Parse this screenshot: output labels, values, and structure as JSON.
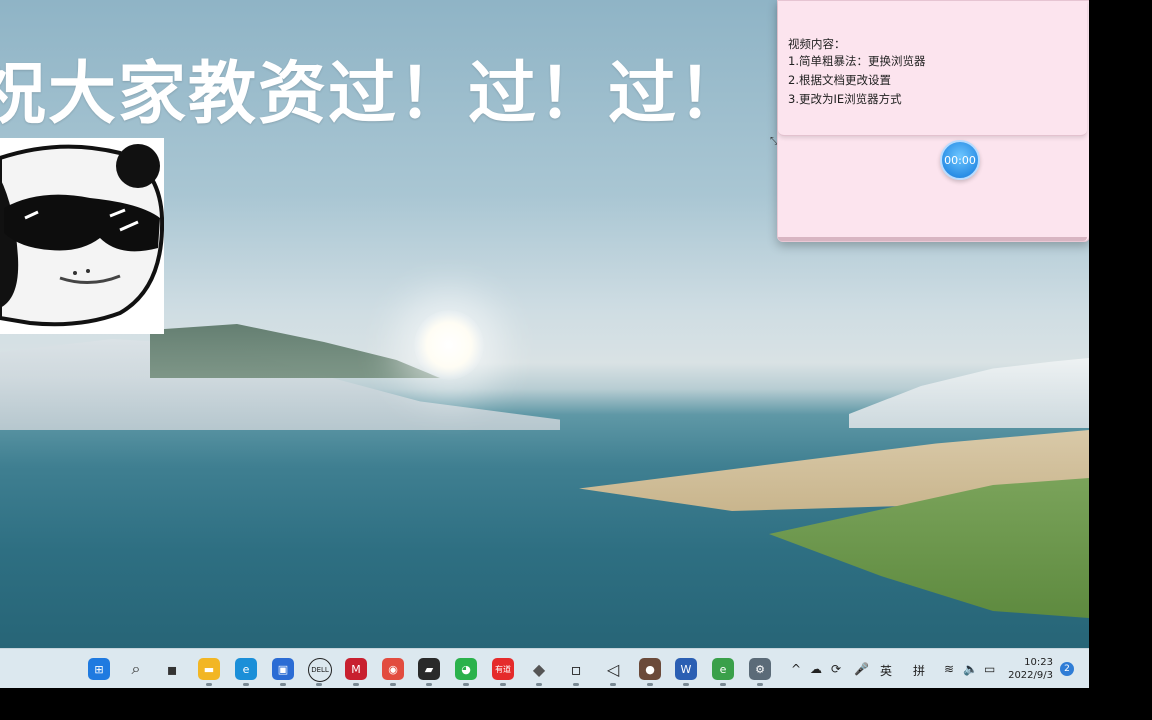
{
  "overlay": {
    "title": "祝大家教资过！过！过！"
  },
  "popup": {
    "header": "视频内容：",
    "lines": [
      "1.简单粗暴法：更换浏览器",
      "2.根据文档更改设置",
      "3.更改为IE浏览器方式"
    ]
  },
  "timer": {
    "label": "00:00"
  },
  "taskbar": {
    "apps": [
      {
        "name": "start-icon",
        "glyph": "⊞",
        "color": "#1f7ae0"
      },
      {
        "name": "search-icon",
        "glyph": "⌕",
        "color": "#333333"
      },
      {
        "name": "task-view-icon",
        "glyph": "▪",
        "color": "#333333"
      },
      {
        "name": "file-explorer-icon",
        "glyph": "▬",
        "color": "#f2b624"
      },
      {
        "name": "edge-icon",
        "glyph": "e",
        "color": "#1b8fd8"
      },
      {
        "name": "store-icon",
        "glyph": "▣",
        "color": "#2b6cd4"
      },
      {
        "name": "dell-icon",
        "glyph": "DELL",
        "color": "#1b1b1b"
      },
      {
        "name": "mcafee-icon",
        "glyph": "M",
        "color": "#c8202f"
      },
      {
        "name": "chrome-icon",
        "glyph": "◉",
        "color": "#e24c3f"
      },
      {
        "name": "sticky-notes-icon",
        "glyph": "▰",
        "color": "#2a2a2a"
      },
      {
        "name": "wechat-icon",
        "glyph": "◕",
        "color": "#2bb24c"
      },
      {
        "name": "youdao-icon",
        "glyph": "有道",
        "color": "#e52b2b"
      },
      {
        "name": "3d-viewer-icon",
        "glyph": "◆",
        "color": "#555555"
      },
      {
        "name": "notepad-app-icon",
        "glyph": "▫",
        "color": "#222222"
      },
      {
        "name": "visual-studio-icon",
        "glyph": "◁",
        "color": "#222222"
      },
      {
        "name": "avatar-app-icon",
        "glyph": "●",
        "color": "#6b4a3a"
      },
      {
        "name": "word-icon",
        "glyph": "W",
        "color": "#2b5fb3"
      },
      {
        "name": "ie-icon",
        "glyph": "e",
        "color": "#3aa04a"
      },
      {
        "name": "settings-icon",
        "glyph": "⚙",
        "color": "#5b6b78"
      }
    ],
    "tray": {
      "chevron": "^",
      "cloud": "☁",
      "sync": "⟳",
      "mic": "🎤",
      "ime_lang": "英",
      "ime_mode": "拼",
      "wifi": "≋",
      "volume": "🔈",
      "battery": "▭"
    },
    "clock": {
      "time": "10:23",
      "date": "2022/9/3"
    },
    "notifications": "2"
  }
}
